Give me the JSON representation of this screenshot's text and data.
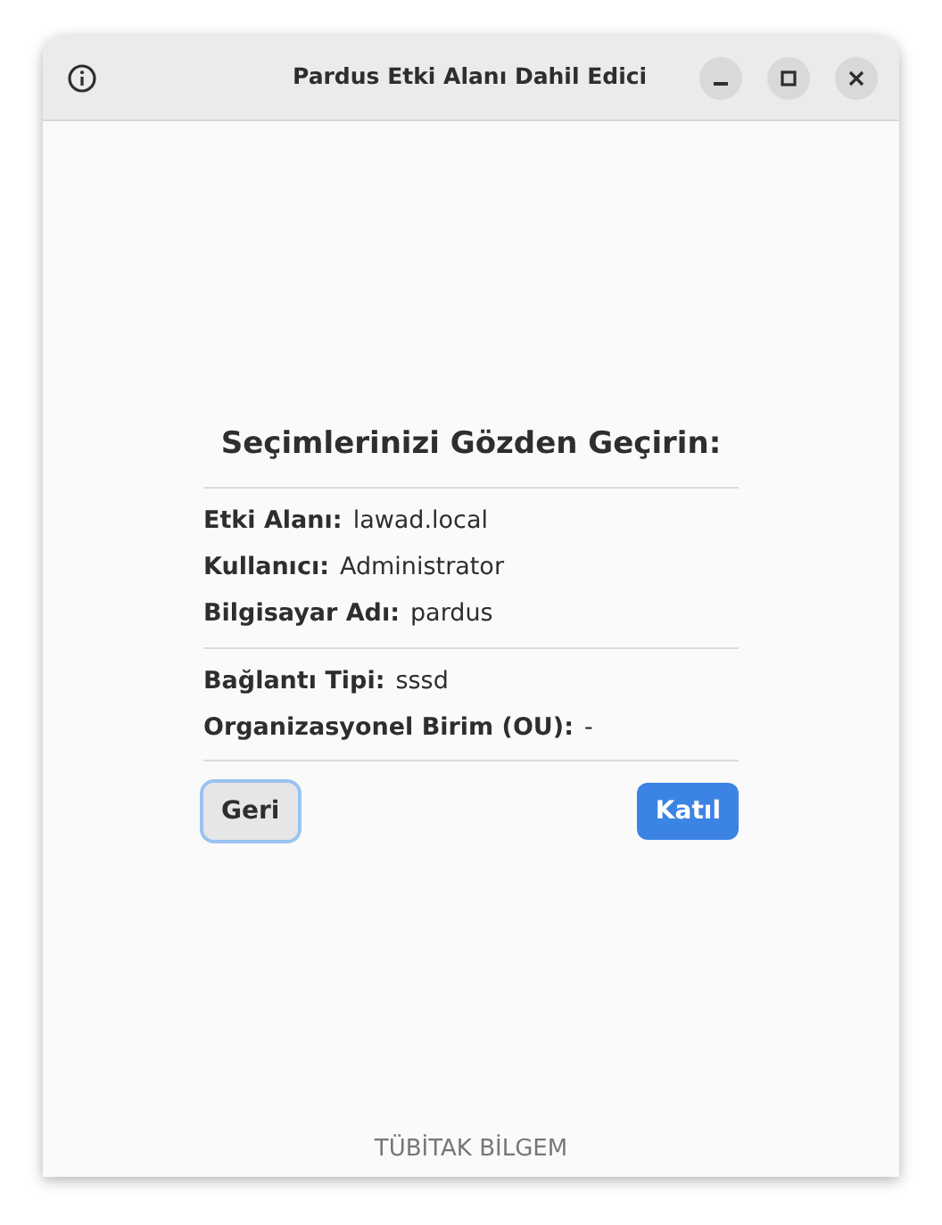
{
  "window": {
    "title": "Pardus Etki Alanı Dahil Edici"
  },
  "heading": "Seçimlerinizi Gözden Geçirin:",
  "groups": [
    [
      {
        "label": "Etki Alanı:",
        "value": "lawad.local"
      },
      {
        "label": "Kullanıcı:",
        "value": "Administrator"
      },
      {
        "label": "Bilgisayar Adı:",
        "value": "pardus"
      }
    ],
    [
      {
        "label": "Bağlantı Tipi:",
        "value": "sssd"
      },
      {
        "label": "Organizasyonel Birim (OU):",
        "value": "-"
      }
    ]
  ],
  "buttons": [
    {
      "label": "Geri",
      "kind": "secondary",
      "focused": true
    },
    {
      "label": "Katıl",
      "kind": "primary",
      "focused": false
    }
  ],
  "footer": "TÜBİTAK BİLGEM"
}
